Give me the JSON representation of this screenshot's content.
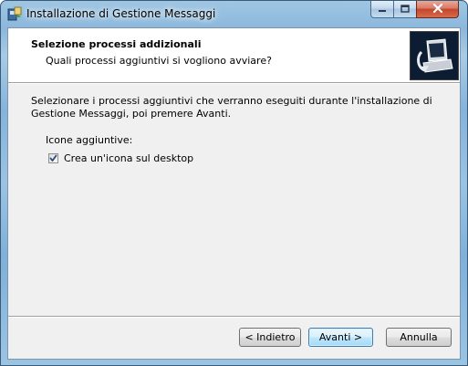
{
  "window": {
    "title": "Installazione di Gestione Messaggi"
  },
  "header": {
    "title": "Selezione processi addizionali",
    "subtitle": "Quali processi aggiuntivi si vogliono avviare?"
  },
  "body": {
    "description": "Selezionare i processi aggiuntivi che verranno eseguiti durante l'installazione di Gestione Messaggi, poi premere Avanti.",
    "section_label": "Icone aggiuntive:",
    "checkbox": {
      "label": "Crea un'icona sul desktop",
      "checked": true
    }
  },
  "buttons": {
    "back": "< Indietro",
    "next": "Avanti >",
    "cancel": "Annulla"
  },
  "colors": {
    "accent_border": "#3c7fb1",
    "close_button": "#c4452c",
    "check_mark": "#2c4a7a"
  }
}
